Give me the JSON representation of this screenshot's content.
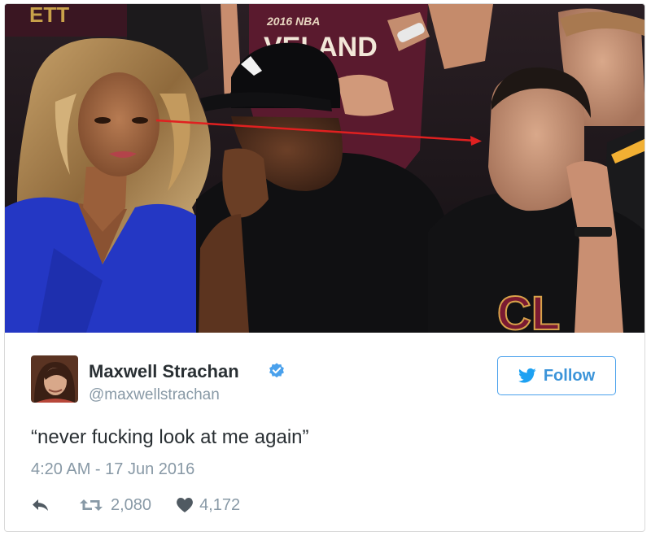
{
  "tweet": {
    "display_name": "Maxwell Strachan",
    "handle": "@maxwellstrachan",
    "follow_label": "Follow",
    "text": "“never fucking look at me again”",
    "timestamp": "4:20 AM - 17 Jun 2016",
    "retweet_count": "2,080",
    "like_count": "4,172",
    "verified": true
  },
  "photo": {
    "shirt_text_top": "2016 NBA",
    "shirt_text_main": "VELAND",
    "shirt_text_front": "CL"
  },
  "icons": {
    "verified": "verified-badge-icon",
    "follow": "bird-icon",
    "reply": "reply-arrow-icon",
    "retweet": "retweet-icon",
    "like": "heart-icon"
  },
  "colors": {
    "brand_blue": "#1da1f2",
    "follow_blue": "#3b94d9",
    "verified_blue": "#4aa1ec",
    "muted_text": "#8899a6",
    "body_text": "#292f33",
    "arrow_red": "#e02020",
    "dress_blue": "#2437c4"
  }
}
